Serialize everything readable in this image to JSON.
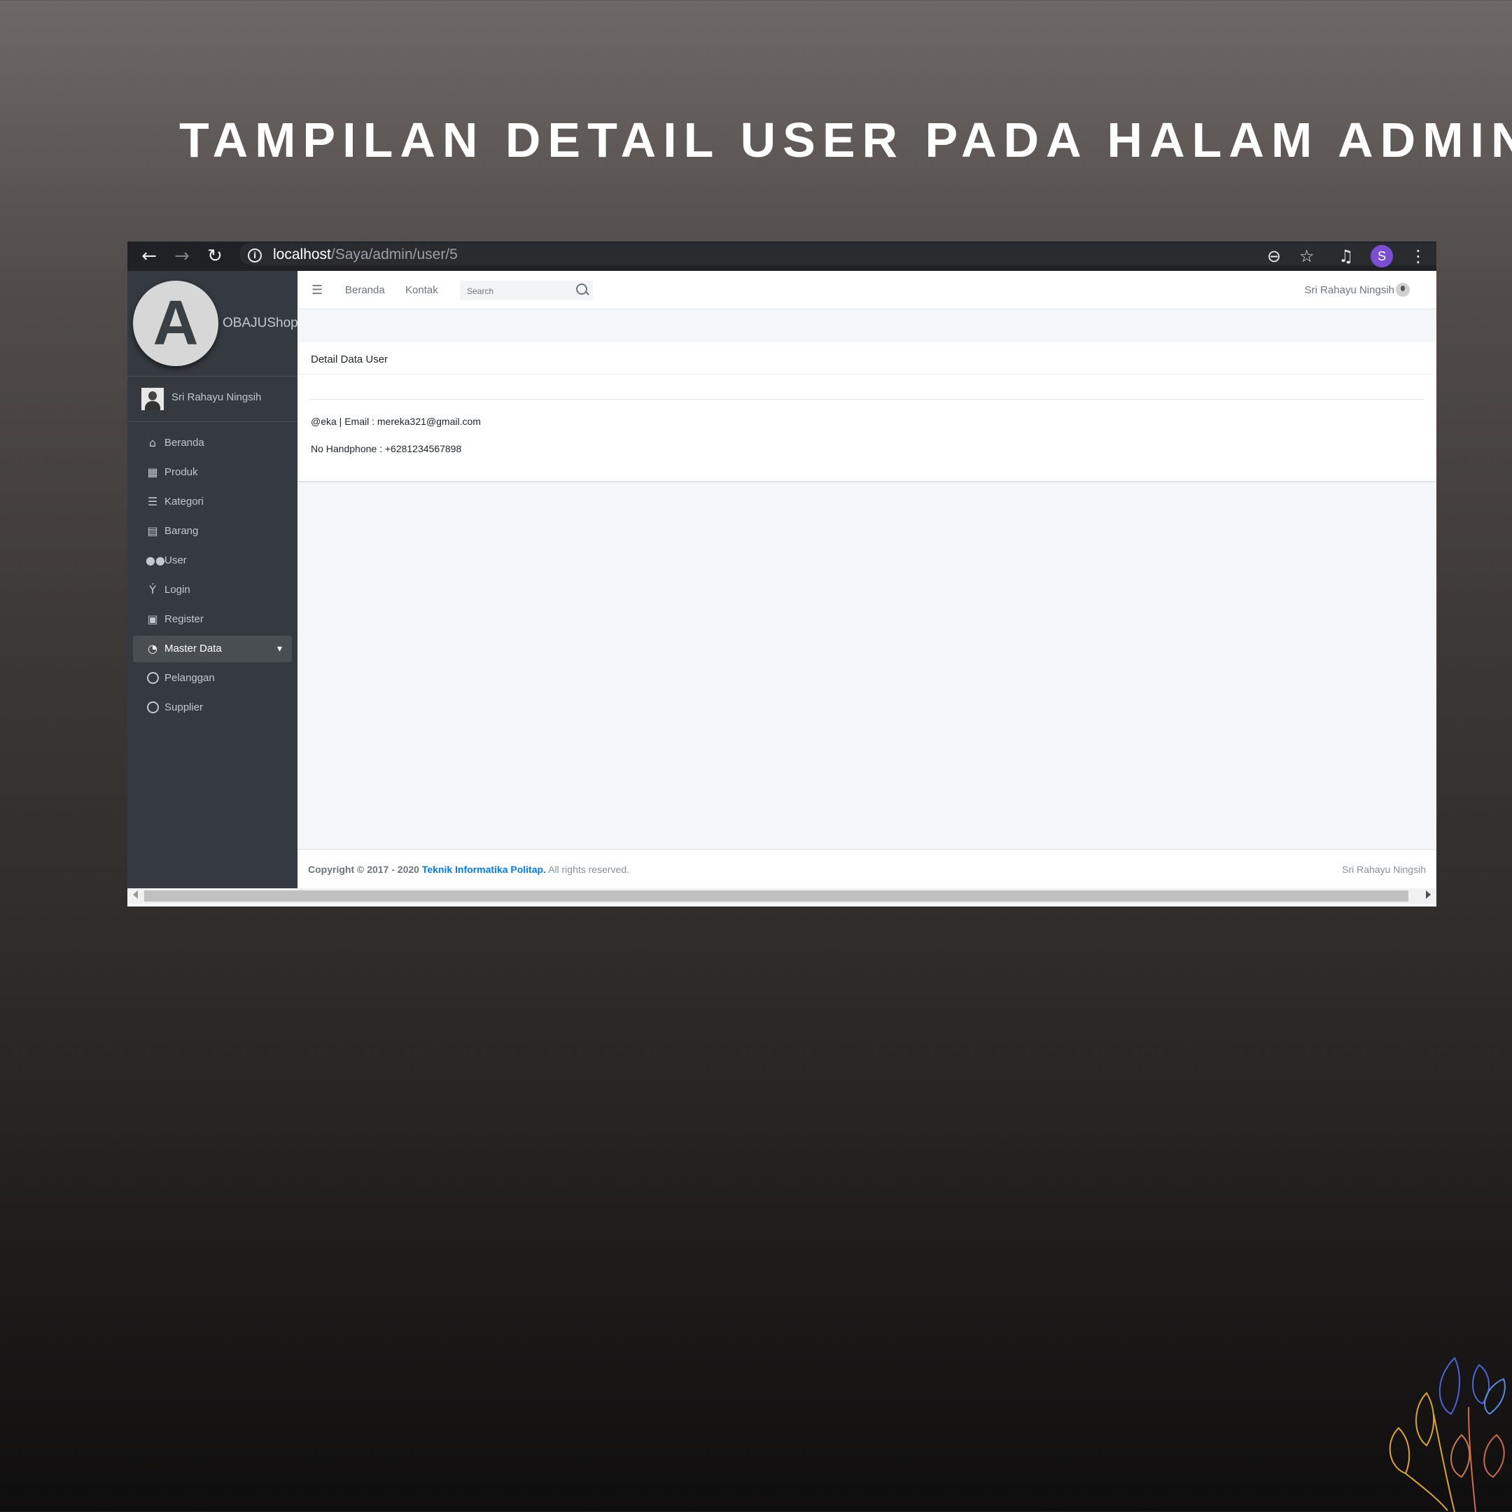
{
  "headline": "TAMPILAN DETAIL USER PADA HALAM ADMIN",
  "browser": {
    "url_host": "localhost",
    "url_path": "/Saya/admin/user/5",
    "profile_initial": "S",
    "profile_color": "#7b4fd3"
  },
  "sidebar": {
    "brand": "OBAJUShop",
    "user_name": "Sri Rahayu Ningsih",
    "items": [
      {
        "label": "Beranda",
        "icon": "home-icon"
      },
      {
        "label": "Produk",
        "icon": "grid-icon"
      },
      {
        "label": "Kategori",
        "icon": "list-icon"
      },
      {
        "label": "Barang",
        "icon": "archive-icon"
      },
      {
        "label": "User",
        "icon": "users-icon"
      },
      {
        "label": "Login",
        "icon": "person-icon"
      },
      {
        "label": "Register",
        "icon": "contact-card-icon"
      },
      {
        "label": "Master Data",
        "icon": "dashboard-icon",
        "active": true
      },
      {
        "label": "Pelanggan",
        "icon": "circle-icon"
      },
      {
        "label": "Supplier",
        "icon": "circle-icon"
      }
    ]
  },
  "topnav": {
    "links": [
      "Beranda",
      "Kontak"
    ],
    "search_placeholder": "Search",
    "user_name": "Sri Rahayu Ningsih"
  },
  "card": {
    "title": "Detail Data User",
    "line1": "@eka | Email : mereka321@gmail.com",
    "line2": "No Handphone : +6281234567898"
  },
  "footer": {
    "prefix": "Copyright © 2017 - 2020 ",
    "org": "Teknik Informatika Politap.",
    "suffix": " All rights reserved.",
    "right": "Sri Rahayu Ningsih"
  },
  "colors": {
    "sidebar_bg": "#343a40",
    "link_blue": "#007bff"
  }
}
